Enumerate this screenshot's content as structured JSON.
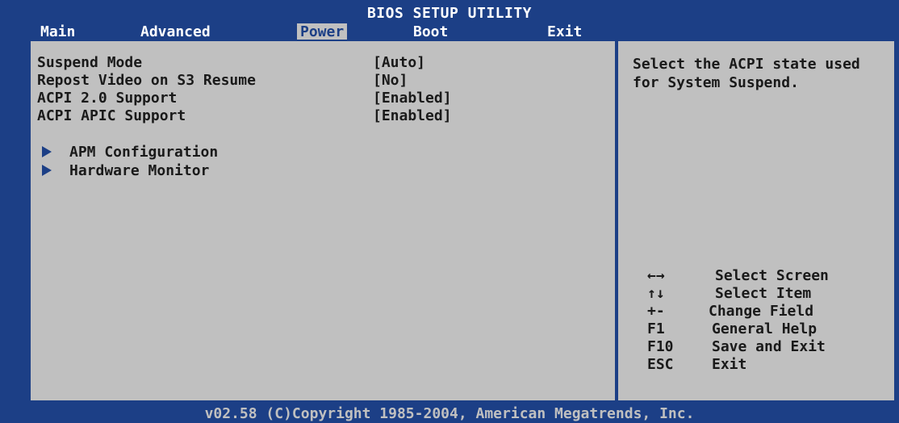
{
  "header": {
    "title": "BIOS SETUP UTILITY",
    "tabs": [
      "Main",
      "Advanced",
      "Power",
      "Boot",
      "Exit"
    ],
    "active_tab": "Power"
  },
  "settings": [
    {
      "label": "Suspend Mode",
      "value": "[Auto]"
    },
    {
      "label": "Repost Video on S3 Resume",
      "value": "[No]"
    },
    {
      "label": "ACPI 2.0 Support",
      "value": "[Enabled]"
    },
    {
      "label": "ACPI APIC Support",
      "value": "[Enabled]"
    }
  ],
  "submenus": [
    {
      "label": "APM Configuration",
      "icon": "submenu-arrow-icon"
    },
    {
      "label": "Hardware Monitor",
      "icon": "submenu-arrow-icon"
    }
  ],
  "help_text": "Select the ACPI state used for System Suspend.",
  "key_legend": [
    {
      "key": "←→",
      "action": "Select Screen"
    },
    {
      "key": "↑↓",
      "action": "Select Item"
    },
    {
      "key": "+-",
      "action": "Change Field"
    },
    {
      "key": "F1",
      "action": "General Help"
    },
    {
      "key": "F10",
      "action": "Save and Exit"
    },
    {
      "key": "ESC",
      "action": "Exit"
    }
  ],
  "footer": "v02.58 (C)Copyright 1985-2004, American Megatrends, Inc.",
  "colors": {
    "bios_blue": "#1c3f86",
    "panel_gray": "#c0c0c0",
    "text_dark": "#1a1a1a",
    "white": "#ffffff"
  }
}
